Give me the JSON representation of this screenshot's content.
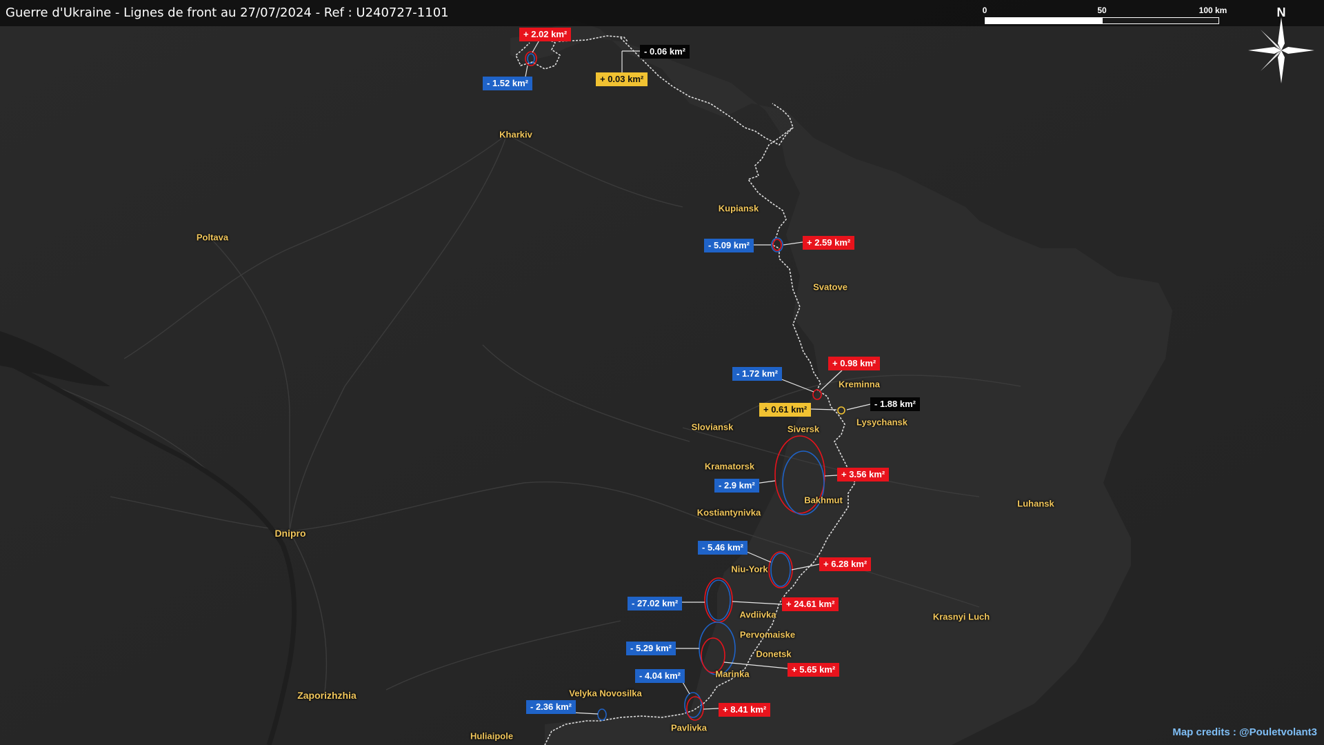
{
  "header": {
    "title": "Guerre d'Ukraine - Lignes de front au 27/07/2024 - Ref : U240727-1101"
  },
  "scale": {
    "ticks": [
      "0",
      "50",
      "100 km"
    ]
  },
  "compass": {
    "label": "N"
  },
  "colors": {
    "background": "#262626",
    "frontline": "#e0e0e0",
    "gain_red": "#e8131c",
    "loss_blue": "#1f63c8",
    "neutral_yellow": "#f1c232",
    "neutral_black": "#050505",
    "city_label": "#f2c75c",
    "credits": "#7fbef5"
  },
  "cities": {
    "kharkiv": "Kharkiv",
    "poltava": "Poltava",
    "kupiansk": "Kupiansk",
    "svatove": "Svatove",
    "kreminna": "Kreminna",
    "lysychansk": "Lysychansk",
    "sloviansk": "Sloviansk",
    "siversk": "Siversk",
    "kramatorsk": "Kramatorsk",
    "bakhmut": "Bakhmut",
    "kostiantynivka": "Kostiantynivka",
    "luhansk": "Luhansk",
    "dnipro": "Dnipro",
    "niu_york": "Niu-York",
    "avdiivka": "Avdiivka",
    "pervomaiske": "Pervomaiske",
    "donetsk": "Donetsk",
    "krasnyi_luch": "Krasnyi Luch",
    "marinka": "Marinka",
    "velyka_novosilka": "Velyka Novosilka",
    "zaporizhzhia": "Zaporizhzhia",
    "pavlivka": "Pavlivka",
    "huliaipole": "Huliaipole"
  },
  "changes": [
    {
      "id": "c1",
      "text": "+ 2.02 km²",
      "kind": "gain"
    },
    {
      "id": "c2",
      "text": "- 1.52 km²",
      "kind": "loss"
    },
    {
      "id": "c3",
      "text": "- 0.06 km²",
      "kind": "black"
    },
    {
      "id": "c4",
      "text": "+ 0.03 km²",
      "kind": "yellow"
    },
    {
      "id": "c5",
      "text": "- 5.09 km²",
      "kind": "loss"
    },
    {
      "id": "c6",
      "text": "+ 2.59 km²",
      "kind": "gain"
    },
    {
      "id": "c7",
      "text": "- 1.72 km²",
      "kind": "loss"
    },
    {
      "id": "c8",
      "text": "+ 0.98 km²",
      "kind": "gain"
    },
    {
      "id": "c9",
      "text": "+ 0.61 km²",
      "kind": "yellow"
    },
    {
      "id": "c10",
      "text": "- 1.88 km²",
      "kind": "black"
    },
    {
      "id": "c11",
      "text": "+ 3.56 km²",
      "kind": "gain"
    },
    {
      "id": "c12",
      "text": "- 2.9 km²",
      "kind": "loss"
    },
    {
      "id": "c13",
      "text": "- 5.46 km²",
      "kind": "loss"
    },
    {
      "id": "c14",
      "text": "+ 6.28 km²",
      "kind": "gain"
    },
    {
      "id": "c15",
      "text": "- 27.02 km²",
      "kind": "loss"
    },
    {
      "id": "c16",
      "text": "+ 24.61 km²",
      "kind": "gain"
    },
    {
      "id": "c17",
      "text": "- 5.29 km²",
      "kind": "loss"
    },
    {
      "id": "c18",
      "text": "+ 5.65 km²",
      "kind": "gain"
    },
    {
      "id": "c19",
      "text": "- 4.04 km²",
      "kind": "loss"
    },
    {
      "id": "c20",
      "text": "- 2.36 km²",
      "kind": "loss"
    },
    {
      "id": "c21",
      "text": "+ 8.41 km²",
      "kind": "gain"
    }
  ],
  "credits": "Map credits : @Pouletvolant3"
}
